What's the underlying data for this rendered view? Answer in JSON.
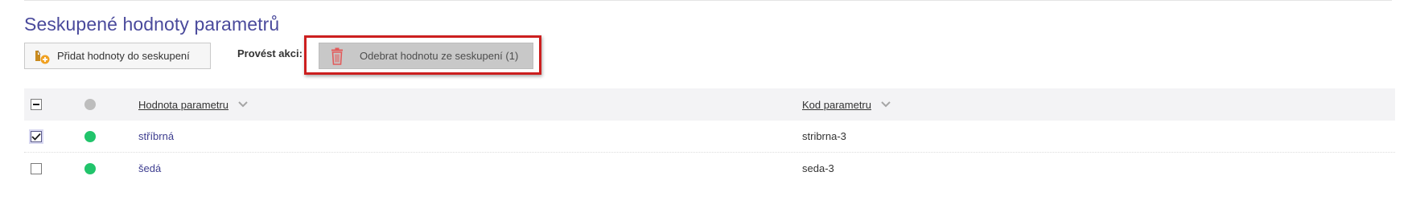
{
  "section": {
    "title": "Seskupené hodnoty parametrů"
  },
  "toolbar": {
    "add_label": "Přidat hodnoty do seskupení",
    "action_label": "Provést akci:",
    "remove_label": "Odebrat hodnotu ze seskupení (1)"
  },
  "colors": {
    "title": "#4a4a9c",
    "highlight": "#cc1f1f",
    "active": "#21c46b",
    "neutral": "#bdbdbd"
  },
  "icons": {
    "add": "add-to-group-icon",
    "remove": "trash-icon",
    "sort": "chevron-down-icon"
  },
  "table": {
    "columns": {
      "value": "Hodnota parametru",
      "code": "Kod parametru"
    },
    "header_select_state": "partial",
    "rows": [
      {
        "name": "stříbrná",
        "code": "stribrna-3",
        "checked": true,
        "status": "active"
      },
      {
        "name": "šedá",
        "code": "seda-3",
        "checked": false,
        "status": "active"
      }
    ]
  }
}
